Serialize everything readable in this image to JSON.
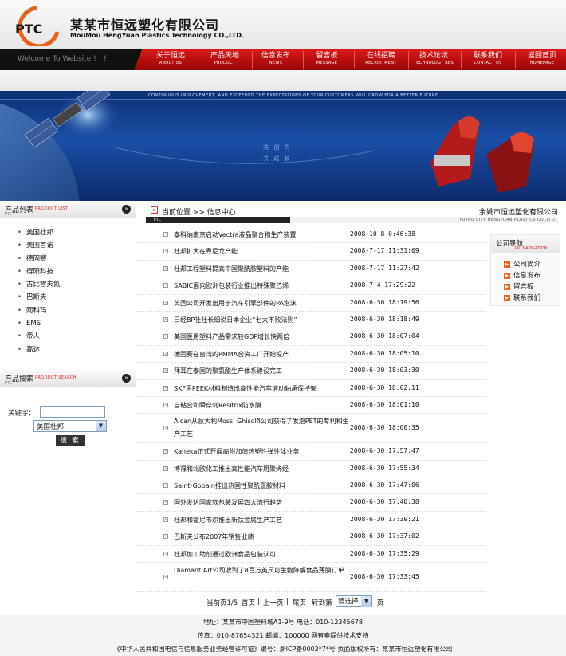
{
  "header": {
    "logo_text": "PTC",
    "company_cn": "某某市恒远塑化有限公司",
    "company_en": "MouMou HengYuan Plastics Technology CO.,LTD."
  },
  "navbar": {
    "welcome": "Welcome To Website ! ! !",
    "items": [
      {
        "cn": "关于恒远",
        "en": "ABOUT US"
      },
      {
        "cn": "产品天地",
        "en": "PRODUCT"
      },
      {
        "cn": "信息发布",
        "en": "NEWS"
      },
      {
        "cn": "留言板",
        "en": "MESSAGE"
      },
      {
        "cn": "在线招聘",
        "en": "RECRUITMENT"
      },
      {
        "cn": "技术论坛",
        "en": "TECHNOLOGY BBS"
      },
      {
        "cn": "联系我们",
        "en": "CONTACT US"
      },
      {
        "cn": "返回首页",
        "en": "HOMEPAGE"
      }
    ]
  },
  "banner": {
    "slogan": "CONTINUOUS IMPROVEMENT, AND EXCEEDED THE EXPECTATIONS OF YOUR CUSTOMERS WILL GROW FOR A BETTER FUTURE",
    "cn_line1": "共 创 的",
    "cn_line2": "共 成 长"
  },
  "product_list": {
    "title_cn": "产品列表",
    "title_en": "PRODUCT LIST",
    "sub": "PTC",
    "items": [
      "美国杜邦",
      "美国首诺",
      "德固赛",
      "得阳科技",
      "古比雪夫氮",
      "巴斯夫",
      "阿科玛",
      "EMS",
      "帝人",
      "高达"
    ]
  },
  "product_search": {
    "title_cn": "产品搜索",
    "title_en": "PRODUCT SEARCH",
    "sub": "PTC",
    "keyword_label": "关键字：",
    "keyword_value": "",
    "selected_brand": "美国杜邦",
    "button": "搜 索"
  },
  "breadcrumb": {
    "label": "当前位置 >> 信息中心",
    "company": "余姚市恒远塑化有限公司",
    "ptc": "PTC",
    "company_en": "YUYAO CITY HENGYUAN PLASTICS CO.,LTD."
  },
  "news": [
    {
      "title": "泰科纳南京启动Vectra液晶聚合物生产装置",
      "date": "2008-10-8 0:46:38"
    },
    {
      "title": "杜邦扩大在粤尼龙产能",
      "date": "2008-7-17 11:31:09"
    },
    {
      "title": "杜邦工程塑料提高中国聚酰胺塑料的产能",
      "date": "2008-7-17 11:27:42"
    },
    {
      "title": "SABIC面向欧洲包装行业推出特殊聚乙烯",
      "date": "2008-7-4 17:29:22"
    },
    {
      "title": "英国公司开发出用于汽车引擎部件的PA泡沫",
      "date": "2008-6-30 18:19:56"
    },
    {
      "title": "日经BP社社长细说日本企业“七大不败法则”",
      "date": "2008-6-30 18:18:49"
    },
    {
      "title": "美国医用塑料产品需求较GDP增长快两倍",
      "date": "2008-6-30 18:07:04"
    },
    {
      "title": "德固赛在台湾的PMMA合资工厂开始投产",
      "date": "2008-6-30 18:05:10"
    },
    {
      "title": "拜耳在泰国的聚氨酯生产体系建设完工",
      "date": "2008-6-30 18:03:30"
    },
    {
      "title": "SKF用PEEK材料制造出高性能汽车滚动轴承保持架",
      "date": "2008-6-30 18:02:11"
    },
    {
      "title": "自粘合和瞬穿刺Resitrix防水膜",
      "date": "2008-6-30 18:01:10"
    },
    {
      "title": "Alcan从意大利Mossi Ghisolfi公司获得了发泡PET的专利和生产工艺",
      "date": "2008-6-30 18:00:35",
      "tall": true
    },
    {
      "title": "Kaneka正式开展高附加值热塑性弹性体业务",
      "date": "2008-6-30 17:57:47"
    },
    {
      "title": "博禄和北欧化工推出高性能汽车用聚烯烃",
      "date": "2008-6-30 17:55:34"
    },
    {
      "title": "Saint-Gobain推出热固性聚酰亚胺材料",
      "date": "2008-6-30 17:47:06"
    },
    {
      "title": "国外发达国家软包装发展四大流行趋势",
      "date": "2008-6-30 17:40:38"
    },
    {
      "title": "杜邦和霍尼韦尔推出新钛金属生产工艺",
      "date": "2008-6-30 17:39:21"
    },
    {
      "title": "巴斯夫公布2007年销售业绩",
      "date": "2008-6-30 17:37:02"
    },
    {
      "title": "杜邦加工助剂通过欧洲食品包装认可",
      "date": "2008-6-30 17:35:29"
    },
    {
      "title": "Diamant Art公司收到了8百万英尺可生物降解食品薄膜订单",
      "date": "2008-6-30 17:33:45",
      "tall": true
    }
  ],
  "pager": {
    "current": "当前页1/5",
    "first": "首页",
    "prev": "上一页",
    "last": "尾页",
    "sep1": "|",
    "sep2": "|",
    "goto": "转到第",
    "select": "请选择",
    "page": "页"
  },
  "side_nav": {
    "title_cn": "公司导航",
    "title_en": "PIC NAVIGATION",
    "items": [
      "公司简介",
      "信息发布",
      "留言板",
      "联系我们"
    ]
  },
  "footer": {
    "line1": "地址：某某市中国塑料城A1-9号  电话：010-12345678",
    "line2": "传真：010-87654321  邮编：100000  网有奏提供技术支持",
    "line3": "《中华人民共和国电信与信息服务业务经营许可证》编号：浙ICP备0002*7*号  页面版权所有：某某市恒远塑化有限公司"
  }
}
